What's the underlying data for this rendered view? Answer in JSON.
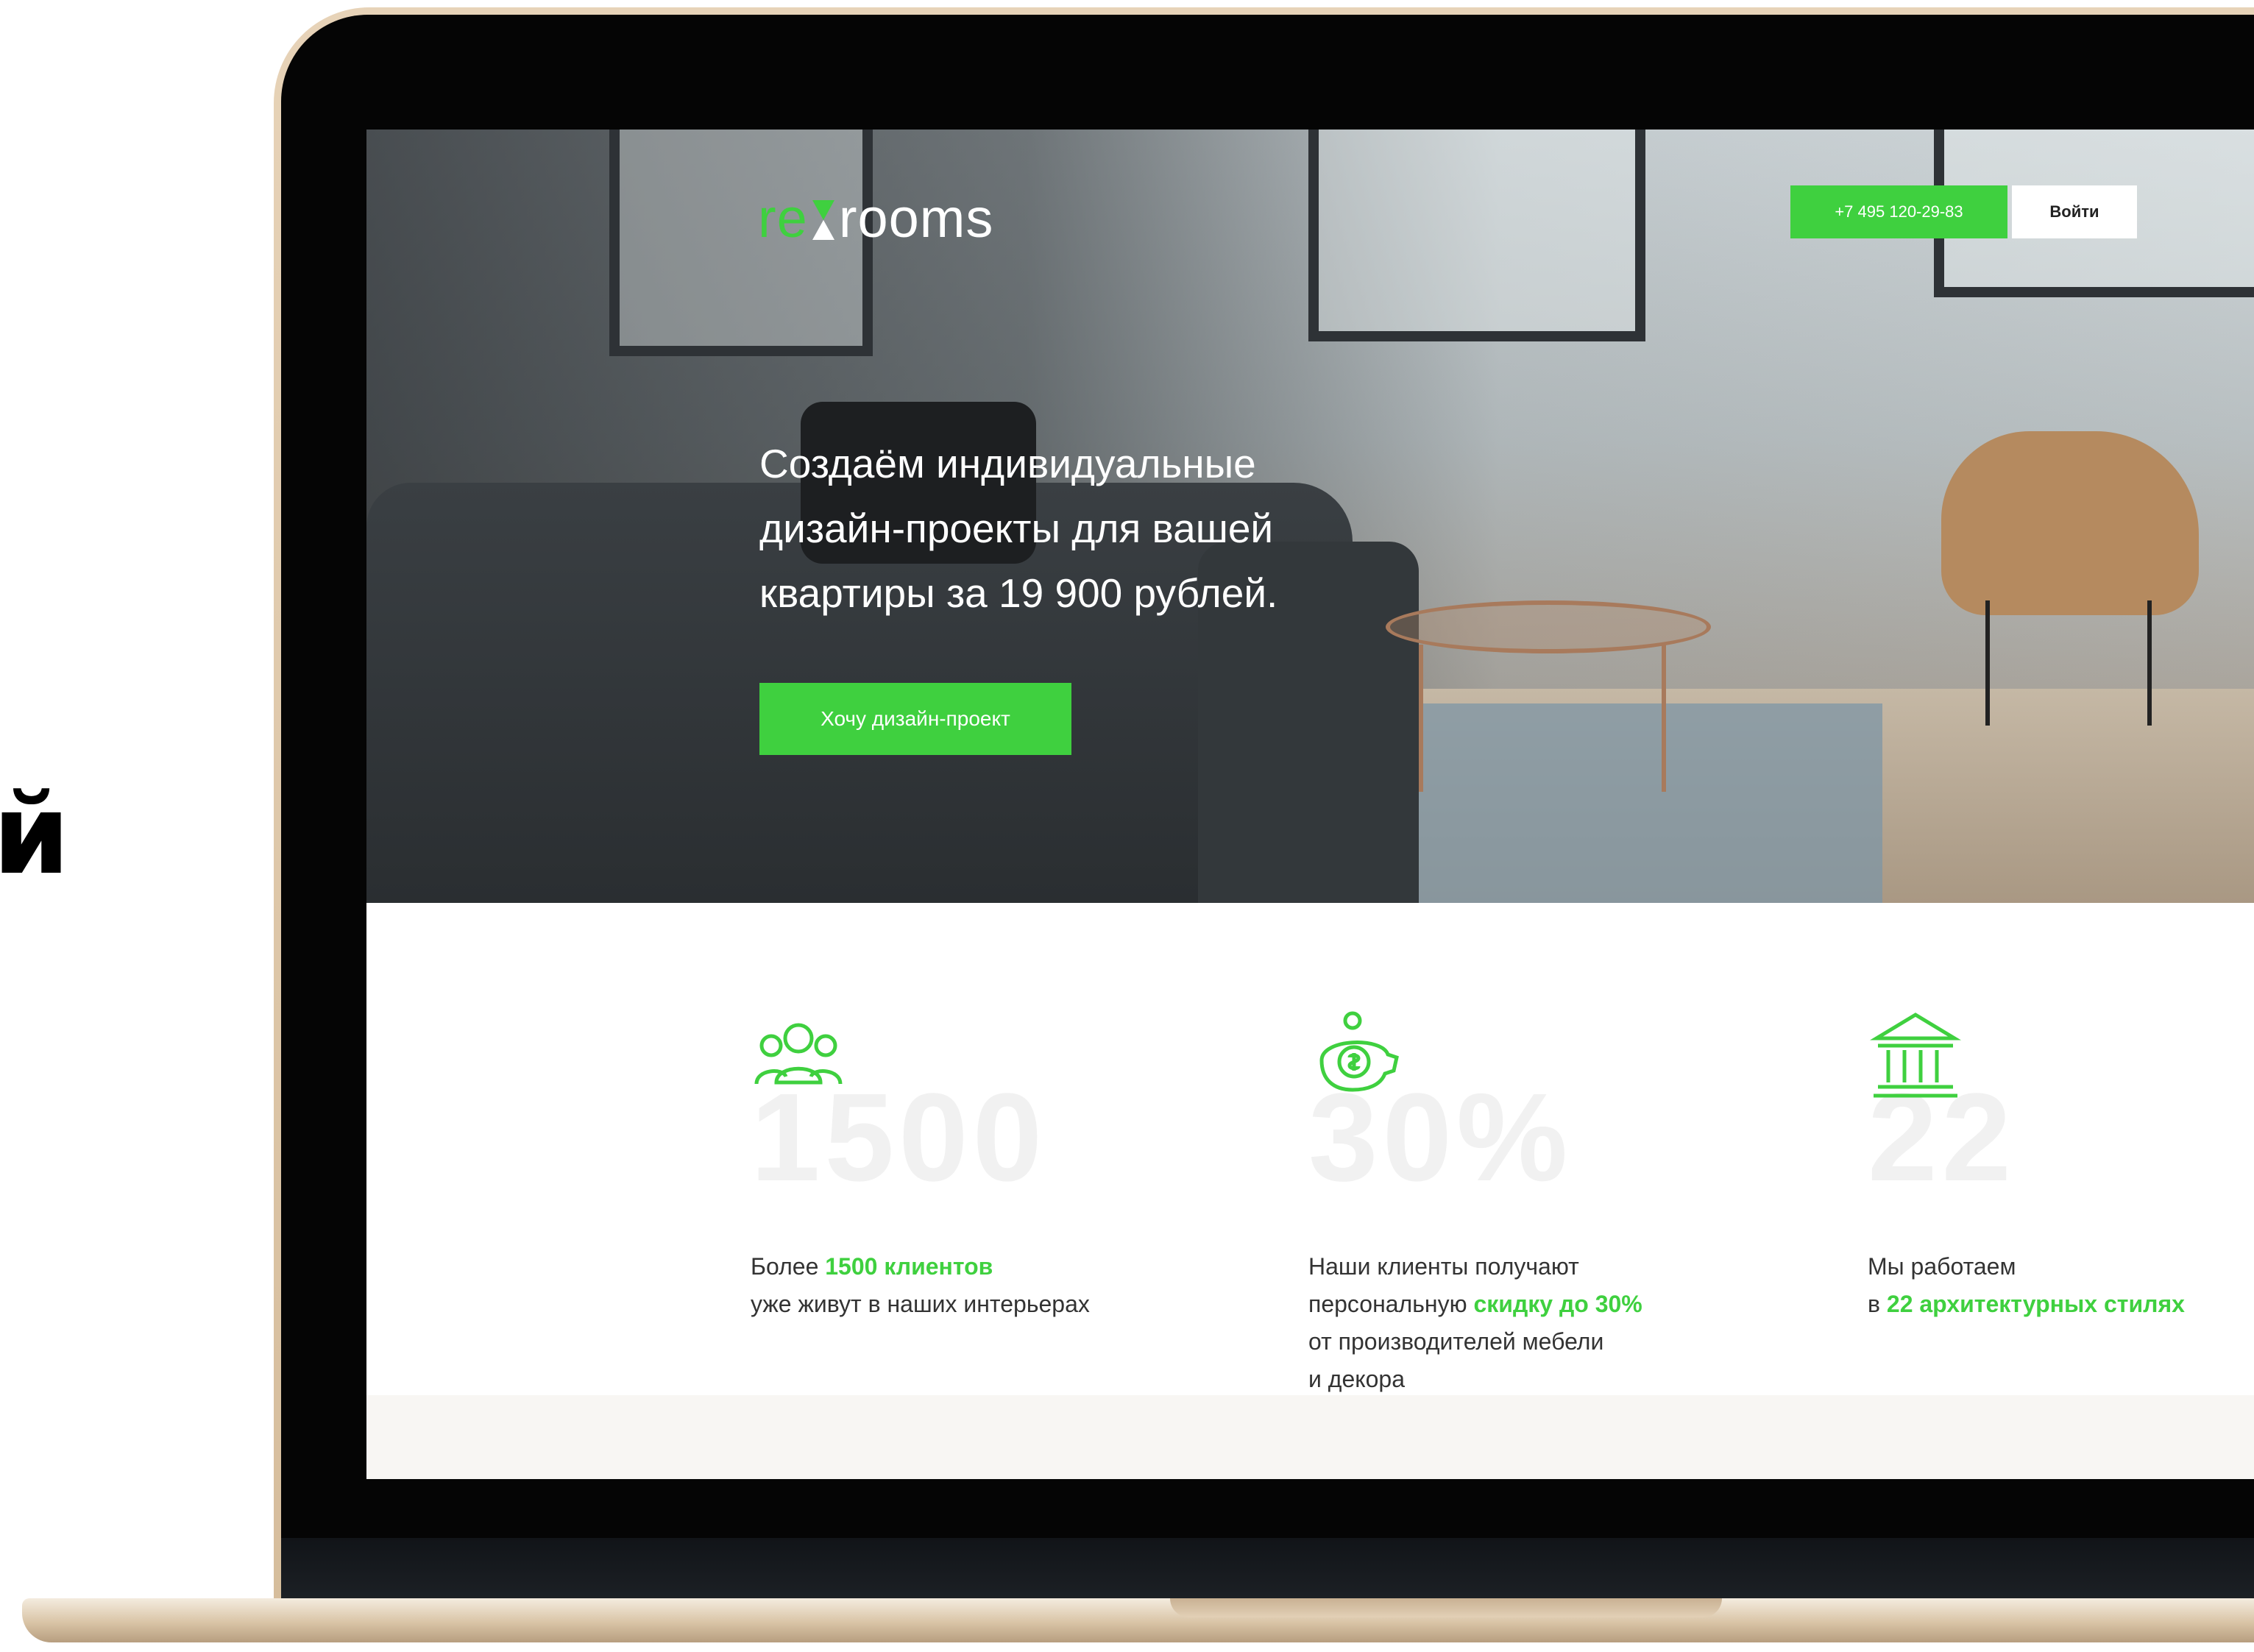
{
  "side_glyph": "й",
  "site": {
    "logo": {
      "prefix": "re",
      "suffix": "rooms"
    },
    "header": {
      "phone_label": "+7 495 120-29-83",
      "login_label": "Войти"
    },
    "hero": {
      "headline_lines": [
        "Создаём индивидуальные",
        "дизайн-проекты для вашей",
        "квартиры за 19 900 рублей."
      ],
      "cta_label": "Хочу дизайн-проект"
    },
    "features": [
      {
        "icon": "people-group-icon",
        "big_number": "1500",
        "lines": [
          {
            "before": "Более ",
            "highlight": "1500 клиентов",
            "after": ""
          },
          {
            "before": "уже живут в наших интерьерах",
            "highlight": "",
            "after": ""
          }
        ]
      },
      {
        "icon": "piggy-bank-icon",
        "big_number": "30%",
        "lines": [
          {
            "before": "Наши клиенты получают",
            "highlight": "",
            "after": ""
          },
          {
            "before": "персональную ",
            "highlight": "скидку до 30%",
            "after": ""
          },
          {
            "before": "от производителей мебели",
            "highlight": "",
            "after": ""
          },
          {
            "before": "и декора",
            "highlight": "",
            "after": ""
          }
        ]
      },
      {
        "icon": "classical-building-icon",
        "big_number": "22",
        "lines": [
          {
            "before": "Мы работаем",
            "highlight": "",
            "after": ""
          },
          {
            "before": "в ",
            "highlight": "22 архитектурных стилях",
            "after": ""
          }
        ]
      }
    ],
    "colors": {
      "accent": "#3fd03f",
      "text": "#333333",
      "bezel": "#050505",
      "laptop_gold": "#e2cba9"
    }
  }
}
